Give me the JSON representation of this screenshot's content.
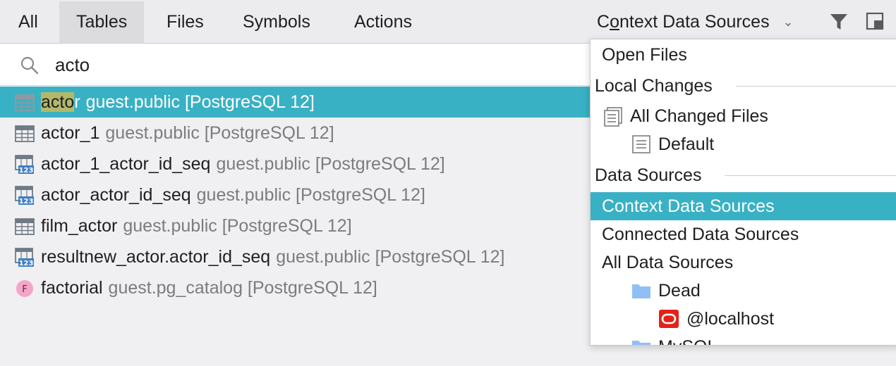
{
  "tabs": [
    {
      "label": "All"
    },
    {
      "label": "Tables"
    },
    {
      "label": "Files"
    },
    {
      "label": "Symbols"
    },
    {
      "label": "Actions"
    }
  ],
  "context_dropdown": {
    "label_pre": "C",
    "label_u": "o",
    "label_post": "ntext Data Sources"
  },
  "search": {
    "value": "acto"
  },
  "results": [
    {
      "highlight": "acto",
      "rest": "r",
      "name": "actor",
      "location": "guest.public [PostgreSQL 12]",
      "icon": "table-icon"
    },
    {
      "name": "actor_1",
      "location": "guest.public [PostgreSQL 12]",
      "icon": "table-icon"
    },
    {
      "name": "actor_1_actor_id_seq",
      "location": "guest.public [PostgreSQL 12]",
      "icon": "sequence-icon"
    },
    {
      "name": "actor_actor_id_seq",
      "location": "guest.public [PostgreSQL 12]",
      "icon": "sequence-icon"
    },
    {
      "name": "film_actor",
      "location": "guest.public [PostgreSQL 12]",
      "icon": "table-icon"
    },
    {
      "name": "resultnew_actor.actor_id_seq",
      "location": "guest.public [PostgreSQL 12]",
      "icon": "sequence-icon"
    },
    {
      "name": "factorial",
      "location": "guest.pg_catalog [PostgreSQL 12]",
      "icon": "function-icon",
      "icon_letter": "F"
    }
  ],
  "popup": {
    "open_files": "Open Files",
    "local_changes": "Local Changes",
    "all_changed_files": "All Changed Files",
    "default": "Default",
    "data_sources": "Data Sources",
    "context_data_sources": "Context Data Sources",
    "connected_data_sources": "Connected Data Sources",
    "all_data_sources": "All Data Sources",
    "dead": "Dead",
    "localhost": "@localhost",
    "mysql": "MySQL"
  },
  "colors": {
    "selection": "#39b1c4",
    "highlight": "#b3b86a",
    "folder": "#8fbff5",
    "oracle": "#e2231a"
  }
}
